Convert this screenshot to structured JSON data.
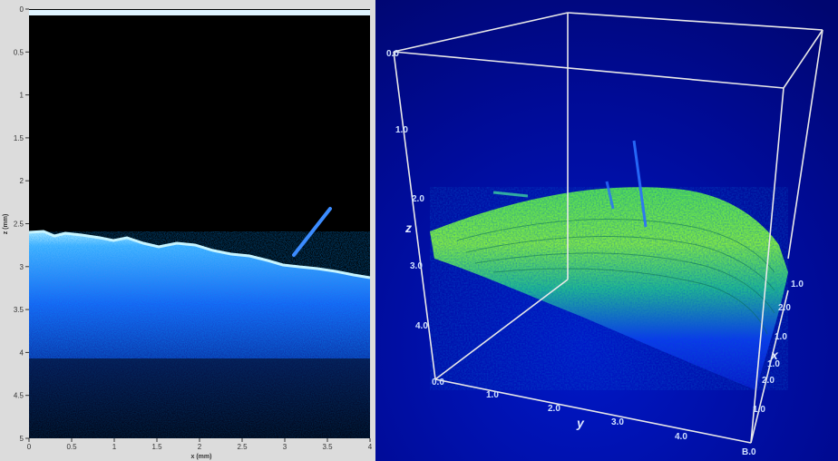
{
  "left_plot": {
    "xlabel": "x (mm)",
    "ylabel": "z (mm)",
    "x_ticks": [
      "0",
      "0.5",
      "1",
      "1.5",
      "2",
      "2.5",
      "3",
      "3.5",
      "4"
    ],
    "y_ticks": [
      "0",
      "0.5",
      "1",
      "1.5",
      "2",
      "2.5",
      "3",
      "3.5",
      "4",
      "4.5",
      "5"
    ],
    "xlim": [
      0,
      4
    ],
    "ylim": [
      0,
      5
    ]
  },
  "right_plot": {
    "z_label": "z",
    "y_label": "y",
    "x_label": "x",
    "z_ticks": [
      "0.0",
      "1.0",
      "2.0",
      "3.0",
      "4.0"
    ],
    "y_ticks": [
      "0.0",
      "1.0",
      "2.0",
      "3.0",
      "4.0",
      "B.0"
    ],
    "x_ticks": [
      "1.0",
      "2.0",
      "1.0",
      "1.0",
      "2.0",
      "1.0"
    ]
  },
  "colors": {
    "left_background": "#000000",
    "left_tissue": "#1e6fff",
    "left_surface": "#a8e6ff",
    "right_background": "#000a8c",
    "right_tissue_top": "#7dff3a",
    "right_tissue_mid": "#1ad07a",
    "right_tissue_bottom": "#0a2aff",
    "box_lines": "#e8e8e8"
  }
}
